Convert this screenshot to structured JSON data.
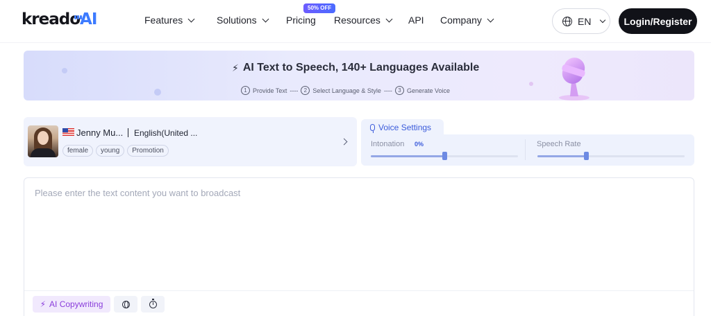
{
  "header": {
    "logo_text": "kreado",
    "logo_ai": "AI",
    "nav": [
      {
        "label": "Features",
        "dropdown": true
      },
      {
        "label": "Solutions",
        "dropdown": true
      },
      {
        "label": "Pricing",
        "dropdown": false,
        "badge": "50% OFF"
      },
      {
        "label": "Resources",
        "dropdown": true
      },
      {
        "label": "API",
        "dropdown": false
      },
      {
        "label": "Company",
        "dropdown": true
      }
    ],
    "language": "EN",
    "login_label": "Login/Register"
  },
  "banner": {
    "title": "AI Text to Speech, 140+ Languages Available",
    "steps": [
      {
        "num": "1",
        "label": "Provide Text"
      },
      {
        "num": "2",
        "label": "Select Language & Style"
      },
      {
        "num": "3",
        "label": "Generate Voice"
      }
    ],
    "step_separator": "----"
  },
  "voice": {
    "name": "Jenny Mu...",
    "language": "English(United ...",
    "tags": [
      "female",
      "young",
      "Promotion"
    ]
  },
  "settings": {
    "tab_label": "Voice Settings",
    "intonation": {
      "label": "Intonation",
      "value_text": "0%",
      "level": 0.5
    },
    "speech_rate": {
      "label": "Speech Rate",
      "level": 0.33
    }
  },
  "editor": {
    "placeholder": "Please enter the text content you want to broadcast",
    "value": "",
    "tools": {
      "ai_copywriting": "AI Copywriting",
      "language_icon": "globe-icon",
      "timer_icon": "stopwatch-icon"
    }
  },
  "colors": {
    "accent": "#3b5bdb",
    "dark_button": "#111218",
    "ai_purple": "#8a3ddb"
  }
}
